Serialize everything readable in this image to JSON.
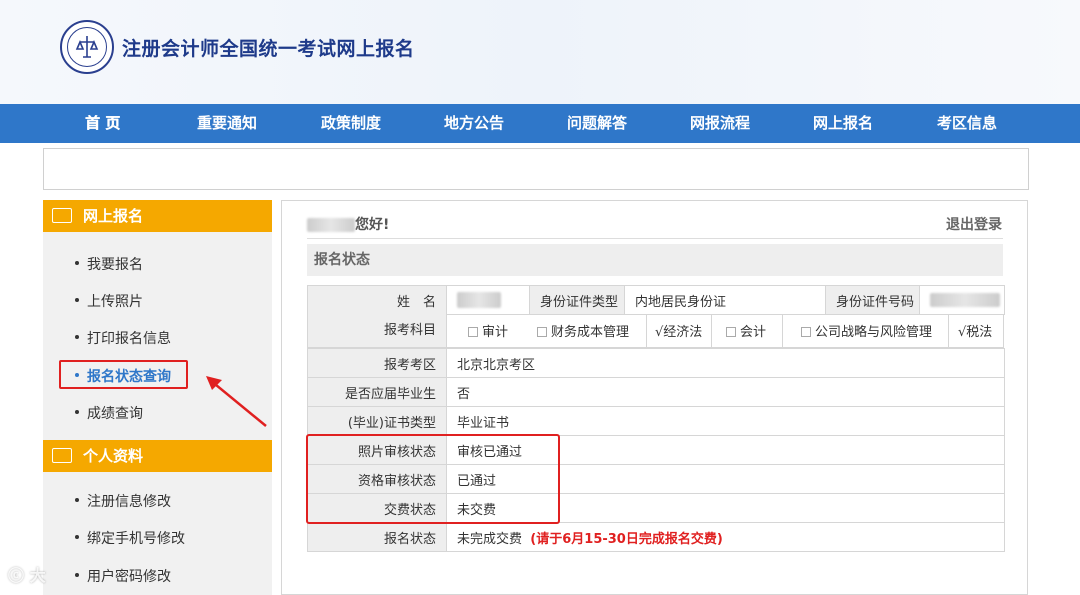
{
  "header": {
    "title": "注册会计师全国统一考试网上报名"
  },
  "nav": [
    "首 页",
    "重要通知",
    "政策制度",
    "地方公告",
    "问题解答",
    "网报流程",
    "网上报名",
    "考区信息"
  ],
  "sidebar": {
    "section1_title": "网上报名",
    "section1_items": [
      "我要报名",
      "上传照片",
      "打印报名信息",
      "报名状态查询",
      "成绩查询"
    ],
    "section2_title": "个人资料",
    "section2_items": [
      "注册信息修改",
      "绑定手机号修改",
      "用户密码修改"
    ]
  },
  "main": {
    "greeting": "您好!",
    "logout": "退出登录",
    "section_title": "报名状态",
    "rows": {
      "name_label": "姓　名",
      "id_type_label": "身份证件类型",
      "id_type_value": "内地居民身份证",
      "id_no_label": "身份证件号码",
      "subjects_label": "报考科目",
      "subjects": [
        {
          "mark": "",
          "name": "审计"
        },
        {
          "mark": "",
          "name": "财务成本管理"
        },
        {
          "mark": "√",
          "name": "经济法"
        },
        {
          "mark": "",
          "name": "会计"
        },
        {
          "mark": "",
          "name": "公司战略与风险管理"
        },
        {
          "mark": "√",
          "name": "税法"
        }
      ],
      "exam_area_label": "报考考区",
      "exam_area_value": "北京北京考区",
      "fresh_grad_label": "是否应届毕业生",
      "fresh_grad_value": "否",
      "cert_type_label": "(毕业)证书类型",
      "cert_type_value": "毕业证书",
      "photo_status_label": "照片审核状态",
      "photo_status_value": "审核已通过",
      "qual_status_label": "资格审核状态",
      "qual_status_value": "已通过",
      "pay_status_label": "交费状态",
      "pay_status_value": "未交费",
      "reg_status_label": "报名状态",
      "reg_status_value": "未完成交费",
      "reg_status_note": "(请于6月15-30日完成报名交费)"
    }
  },
  "watermark": "大"
}
